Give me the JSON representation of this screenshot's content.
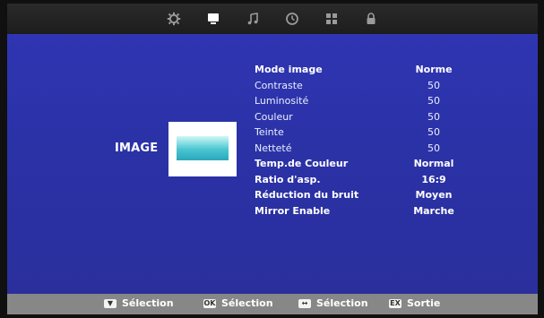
{
  "tabs": [
    {
      "icon": "gear-icon",
      "active": false
    },
    {
      "icon": "monitor-icon",
      "active": true
    },
    {
      "icon": "music-note-icon",
      "active": false
    },
    {
      "icon": "clock-icon",
      "active": false
    },
    {
      "icon": "grid-icon",
      "active": false
    },
    {
      "icon": "lock-icon",
      "active": false
    }
  ],
  "section": {
    "title": "IMAGE"
  },
  "menu": [
    {
      "label": "Mode image",
      "value": "Norme",
      "bold": true
    },
    {
      "label": "Contraste",
      "value": "50",
      "bold": false
    },
    {
      "label": "Luminosité",
      "value": "50",
      "bold": false
    },
    {
      "label": "Couleur",
      "value": "50",
      "bold": false
    },
    {
      "label": "Teinte",
      "value": "50",
      "bold": false
    },
    {
      "label": "Netteté",
      "value": "50",
      "bold": false
    },
    {
      "label": "Temp.de Couleur",
      "value": "Normal",
      "bold": true
    },
    {
      "label": "Ratio d'asp.",
      "value": "16:9",
      "bold": true
    },
    {
      "label": "Réduction du bruit",
      "value": "Moyen",
      "bold": true
    },
    {
      "label": "Mirror Enable",
      "value": "Marche",
      "bold": true
    }
  ],
  "footer": [
    {
      "icon": "updown-key-icon",
      "label": "Sélection"
    },
    {
      "icon": "ok-key-icon",
      "label": "Sélection"
    },
    {
      "icon": "leftright-key-icon",
      "label": "Sélection"
    },
    {
      "icon": "exit-key-icon",
      "label": "Sortie"
    }
  ]
}
